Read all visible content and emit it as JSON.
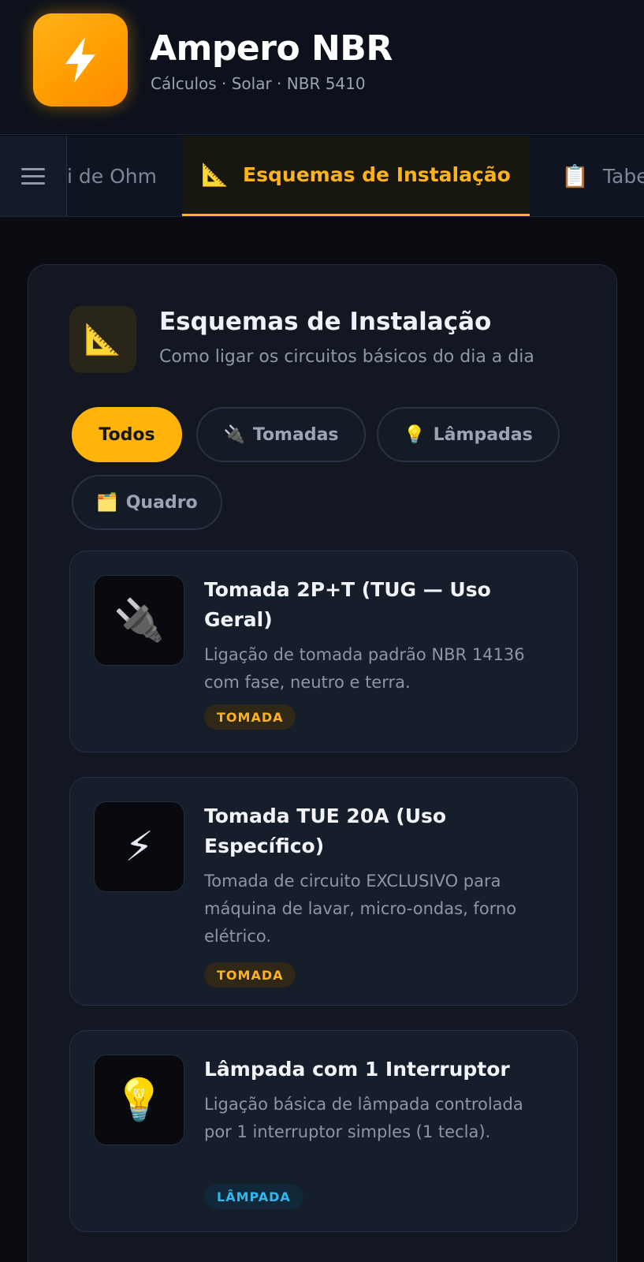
{
  "app": {
    "title": "Ampero NBR",
    "subtitle": "Cálculos · Solar · NBR 5410",
    "logo_icon": "lightning-bolt-icon",
    "accent_color": "#ffb21a"
  },
  "tabs": [
    {
      "label": "i de Ohm",
      "icon": "",
      "active": false
    },
    {
      "label": "Esquemas de Instalação",
      "icon": "📐",
      "active": true
    },
    {
      "label": "Tabe",
      "icon": "📋",
      "active": false
    }
  ],
  "section": {
    "icon": "📐",
    "title": "Esquemas de Instalação",
    "subtitle": "Como ligar os circuitos básicos do dia a dia"
  },
  "filters": [
    {
      "label": "Todos",
      "icon": "",
      "active": true
    },
    {
      "label": "Tomadas",
      "icon": "🔌",
      "active": false
    },
    {
      "label": "Lâmpadas",
      "icon": "💡",
      "active": false
    },
    {
      "label": "Quadro",
      "icon": "🗂️",
      "active": false
    }
  ],
  "schemes": [
    {
      "icon": "🔌",
      "title": "Tomada 2P+T (TUG — Uso Geral)",
      "description": "Ligação de tomada padrão NBR 14136 com fase, neutro e terra.",
      "badge": "TOMADA",
      "badge_color": "#ffb21a"
    },
    {
      "icon": "⚡",
      "title": "Tomada TUE 20A (Uso Específico)",
      "description": "Tomada de circuito EXCLUSIVO para máquina de lavar, micro-ondas, forno elétrico.",
      "badge": "TOMADA",
      "badge_color": "#ffb21a"
    },
    {
      "icon": "💡",
      "title": "Lâmpada com 1 Interruptor",
      "description": "Ligação básica de lâmpada controlada por 1 interruptor simples (1 tecla).",
      "badge": "LÂMPADA",
      "badge_color": "#32b8ee"
    }
  ]
}
